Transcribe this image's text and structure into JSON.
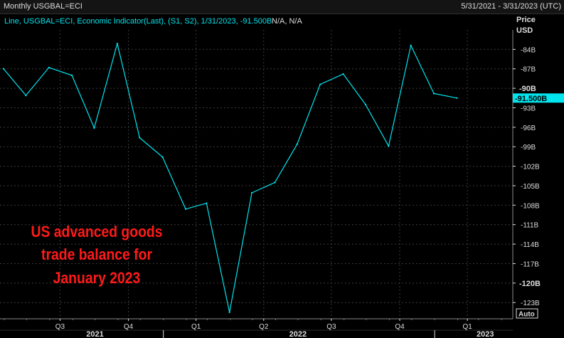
{
  "header": {
    "title": "Monthly USGBAL=ECI",
    "date_range": "5/31/2021 - 3/31/2023 (UTC)"
  },
  "legend": {
    "prefix": "Line, USGBAL=ECI, Economic Indicator(Last), (S1, S2), 1/31/2023, -91.500B",
    "suffix": "N/A, N/A"
  },
  "axis": {
    "title_line1": "Price",
    "title_line2": "USD",
    "auto_label": "Auto"
  },
  "annotation": {
    "lines": [
      "US advanced goods",
      "trade balance for",
      "January 2023"
    ]
  },
  "chart_data": {
    "type": "line",
    "title": "Monthly USGBAL=ECI",
    "series": [
      {
        "name": "USGBAL=ECI",
        "x": [
          "2021-05-31",
          "2021-06-30",
          "2021-07-31",
          "2021-08-31",
          "2021-09-30",
          "2021-10-31",
          "2021-11-30",
          "2021-12-31",
          "2022-01-31",
          "2022-02-28",
          "2022-03-31",
          "2022-04-30",
          "2022-05-31",
          "2022-06-30",
          "2022-07-31",
          "2022-08-31",
          "2022-09-30",
          "2022-10-31",
          "2022-11-30",
          "2022-12-31",
          "2023-01-31"
        ],
        "values": [
          -87.0,
          -91.1,
          -86.8,
          -88.0,
          -96.1,
          -83.1,
          -97.6,
          -100.6,
          -108.6,
          -107.7,
          -124.5,
          -106.1,
          -104.5,
          -98.6,
          -89.4,
          -87.8,
          -92.5,
          -98.9,
          -83.4,
          -90.8,
          -91.5
        ]
      }
    ],
    "last_value_label": "-91.500B",
    "last_value": -91.5,
    "y_ticks": [
      {
        "value": -84,
        "label": "-84B"
      },
      {
        "value": -87,
        "label": "-87B"
      },
      {
        "value": -90,
        "label": "-90B"
      },
      {
        "value": -93,
        "label": "-93B"
      },
      {
        "value": -96,
        "label": "-96B"
      },
      {
        "value": -99,
        "label": "-99B"
      },
      {
        "value": -102,
        "label": "-102B"
      },
      {
        "value": -105,
        "label": "-105B"
      },
      {
        "value": -108,
        "label": "-108B"
      },
      {
        "value": -111,
        "label": "-111B"
      },
      {
        "value": -114,
        "label": "-114B"
      },
      {
        "value": -117,
        "label": "-117B"
      },
      {
        "value": -120,
        "label": "-120B"
      },
      {
        "value": -123,
        "label": "-123B"
      }
    ],
    "emphasized_y_ticks": [
      "-90B",
      "-120B"
    ],
    "ylim": [
      -125.5,
      -81.0
    ],
    "x_quarter_ticks": [
      {
        "date": "2021-08-15",
        "label": "Q3"
      },
      {
        "date": "2021-11-15",
        "label": "Q4"
      },
      {
        "date": "2022-02-14",
        "label": "Q1"
      },
      {
        "date": "2022-05-16",
        "label": "Q2"
      },
      {
        "date": "2022-08-15",
        "label": "Q3"
      },
      {
        "date": "2022-11-15",
        "label": "Q4"
      },
      {
        "date": "2023-02-14",
        "label": "Q1"
      }
    ],
    "x_year_ticks": [
      {
        "date": "2021-10-01",
        "label": "2021"
      },
      {
        "date": "2022-07-01",
        "label": "2022"
      },
      {
        "date": "2023-03-10",
        "label": "2023"
      }
    ],
    "year_boundaries": [
      "2022-01-01",
      "2023-01-01"
    ],
    "xlim": [
      "2021-05-31",
      "2023-03-31"
    ],
    "grid": true,
    "colors": {
      "line": "#00e5ee",
      "grid": "#3a3a3a",
      "background": "#000000",
      "text": "#dcdcdc",
      "annotation": "#ff1a1a",
      "price_tag_bg": "#00e5ee",
      "price_tag_text": "#000000"
    }
  }
}
